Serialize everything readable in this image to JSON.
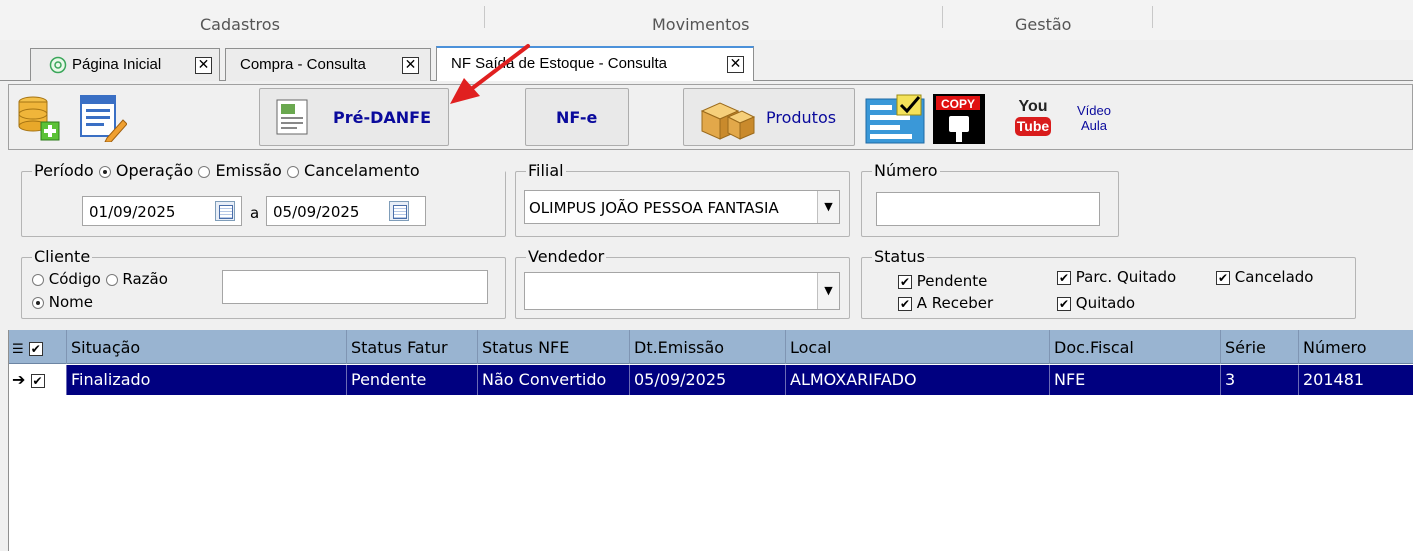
{
  "menu": {
    "items": [
      "Cadastros",
      "Movimentos",
      "Gestão"
    ]
  },
  "tabs": [
    {
      "label": "Página Inicial"
    },
    {
      "label": "Compra - Consulta"
    },
    {
      "label": "NF Saída de Estoque - Consulta"
    }
  ],
  "toolbar": {
    "predanfe_label": "Pré-DANFE",
    "nfe_label": "NF-e",
    "produtos_label": "Produtos",
    "copy_label": "COPY",
    "youtube_you": "You",
    "youtube_tube": "Tube",
    "video_line1": "Vídeo",
    "video_line2": "Aula"
  },
  "periodo": {
    "legend": "Período",
    "options": [
      "Operação",
      "Emissão",
      "Cancelamento"
    ],
    "selected": "Operação",
    "date_from": "01/09/2025",
    "date_sep": "a",
    "date_to": "05/09/2025"
  },
  "filial": {
    "legend": "Filial",
    "value": "OLIMPUS JOÃO PESSOA FANTASIA"
  },
  "numero": {
    "legend": "Número",
    "value": ""
  },
  "cliente": {
    "legend": "Cliente",
    "options": [
      "Código",
      "Razão",
      "Nome"
    ],
    "selected": "Nome",
    "value": ""
  },
  "vendedor": {
    "legend": "Vendedor",
    "value": ""
  },
  "status": {
    "legend": "Status",
    "checks": [
      {
        "label": "Pendente",
        "checked": true
      },
      {
        "label": "Parc. Quitado",
        "checked": true
      },
      {
        "label": "Cancelado",
        "checked": true
      },
      {
        "label": "A Receber",
        "checked": true
      },
      {
        "label": "Quitado",
        "checked": true
      }
    ]
  },
  "grid": {
    "columns": [
      "Situação",
      "Status Fatur",
      "Status NFE",
      "Dt.Emissão",
      "Local",
      "Doc.Fiscal",
      "Série",
      "Número"
    ],
    "rows": [
      [
        "Finalizado",
        "Pendente",
        "Não Convertido",
        "05/09/2025",
        "ALMOXARIFADO",
        "NFE",
        "3",
        "201481"
      ]
    ]
  },
  "colors": {
    "header_bg": "#99b4d1",
    "selected_row_bg": "#000080",
    "active_tab_accent": "#4a90d9",
    "arrow": "#e02020"
  }
}
